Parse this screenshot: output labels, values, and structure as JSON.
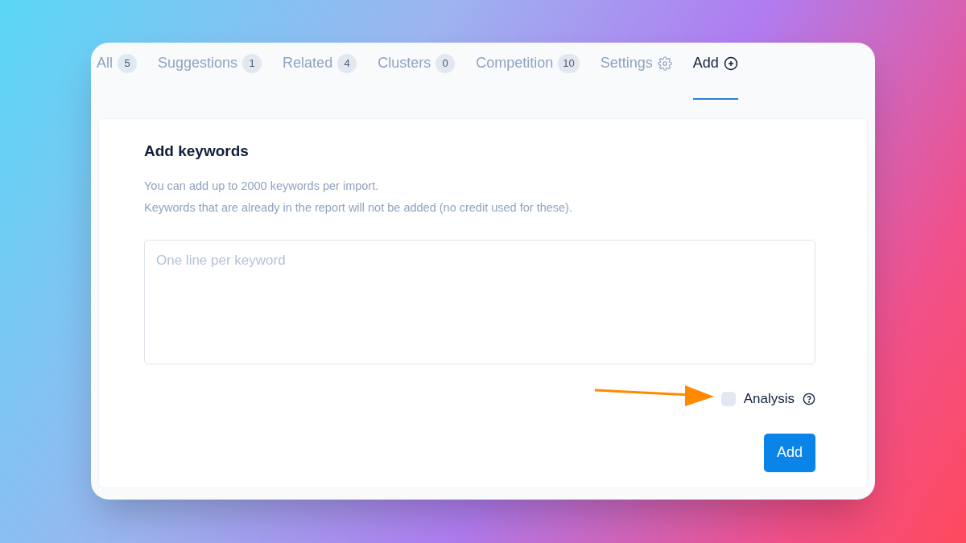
{
  "tabs": [
    {
      "label": "All",
      "kind": "count",
      "count": "5",
      "selected": false
    },
    {
      "label": "Suggestions",
      "kind": "count",
      "count": "1",
      "selected": false
    },
    {
      "label": "Related",
      "kind": "count",
      "count": "4",
      "selected": false
    },
    {
      "label": "Clusters",
      "kind": "count",
      "count": "0",
      "selected": false
    },
    {
      "label": "Competition",
      "kind": "count",
      "count": "10",
      "selected": false
    },
    {
      "label": "Settings",
      "kind": "gear",
      "selected": false
    },
    {
      "label": "Add",
      "kind": "plus",
      "selected": true
    }
  ],
  "panel": {
    "title": "Add keywords",
    "notes": [
      "You can add up to 2000 keywords per import.",
      "Keywords that are already in the report will not be added (no credit used for these)."
    ],
    "keywords_field": {
      "placeholder": "One line per keyword"
    },
    "analysis": {
      "label": "Analysis",
      "checked": false
    },
    "button": "Add"
  }
}
